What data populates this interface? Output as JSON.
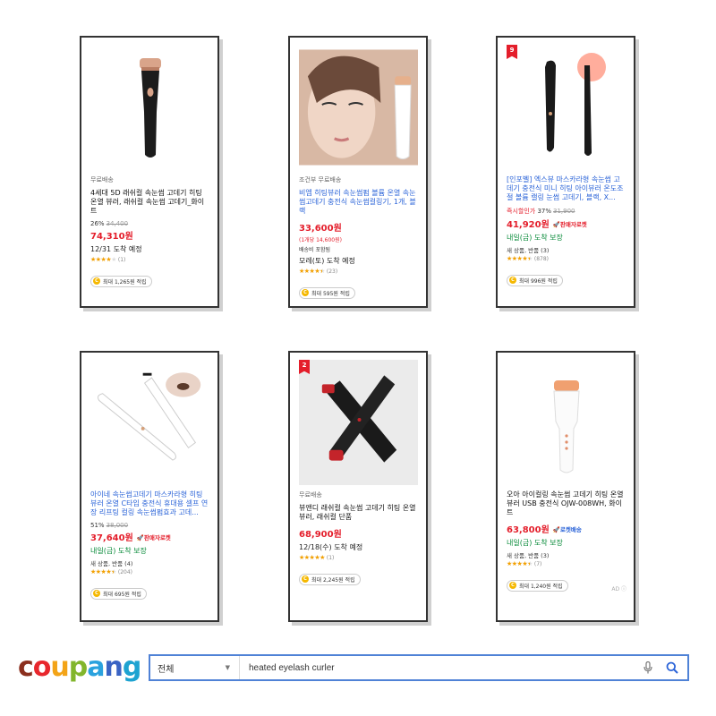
{
  "products": [
    {
      "tag": "무료배송",
      "name": "4세대 5D 래쉬컬 속눈썹 고데기 히팅 온열 뷰러, 래쉬컬 속눈썹 고데기_화이트",
      "discount": "26%",
      "original_price": "34,400",
      "price": "74,310원",
      "delivery": "12/31 도착 예정",
      "rating": 4.0,
      "reviews": "(1)",
      "cashback": "최대 1,265원 적립"
    },
    {
      "tag": "조건부 무료배송",
      "name": "비엠 히팅뷰러 속눈썹펌 볼륨 온열 속눈썹고데기 충전식 속눈썹컬링기, 1개, 블랙",
      "price": "33,600원",
      "unit_price": "(1개당 14,600원)",
      "shipping": "배송비 포함됨",
      "delivery": "모레(토) 도착 예정",
      "rating": 4.5,
      "reviews": "(23)",
      "cashback": "최대 595원 적립"
    },
    {
      "rank": "9",
      "name": "[인포벨] 엑스뷰 마스카라형 속눈썹 고데기 충전식 미니 히팅 아이뷰러 온도조절 볼륨 캘링 눈썹 고데기, 블랙, X...",
      "deal_label": "즉시할인가",
      "discount": "37%",
      "original_price": "31,900",
      "price": "41,920원",
      "rocket": "판매자로켓",
      "delivery": "내일(금) 도착 보장",
      "seller_note": "새 상품, 반품 (3)",
      "rating": 4.5,
      "reviews": "(878)",
      "cashback": "최대 996원 적립"
    },
    {
      "name": "아이네 속눈썹고데기 마스카라형 히팅 뷰러 온열 C타입 충전식 휴대용 셀프 연장 리프팅 컬링 속눈썹펌효과 고데...",
      "discount": "51%",
      "original_price": "38,000",
      "price": "37,640원",
      "rocket": "판매자로켓",
      "delivery": "내일(금) 도착 보장",
      "seller_note": "새 상품, 반품 (4)",
      "rating": 4.5,
      "reviews": "(204)",
      "cashback": "최대 695원 적립"
    },
    {
      "rank": "2",
      "tag": "무료배송",
      "name": "뷰앤디 래쉬컬 속눈썹 고데기 히팅 온열 뷰러, 래쉬컬 단품",
      "price": "68,900원",
      "delivery": "12/18(수) 도착 예정",
      "rating": 5.0,
      "reviews": "(1)",
      "cashback": "최대 2,245원 적립"
    },
    {
      "name": "오아 아이컬링 속눈썹 고데기 히팅 온열 뷰러 USB 충전식 OJW-008WH, 화이트",
      "price": "63,800원",
      "rocket": "로켓배송",
      "delivery": "내일(금) 도착 보장",
      "seller_note": "새 상품, 반품 (3)",
      "rating": 4.5,
      "reviews": "(7)",
      "cashback": "최대 1,240원 적립",
      "ad": "AD"
    }
  ],
  "search": {
    "logo": "coupang",
    "logo_colors": [
      "#8b2f1e",
      "#e8272d",
      "#f3a418",
      "#82b62c",
      "#2ba2de",
      "#3a63c4",
      "#1ea3d1"
    ],
    "category": "전체",
    "query": "heated eyelash curler",
    "accent": "#4f82d6"
  }
}
